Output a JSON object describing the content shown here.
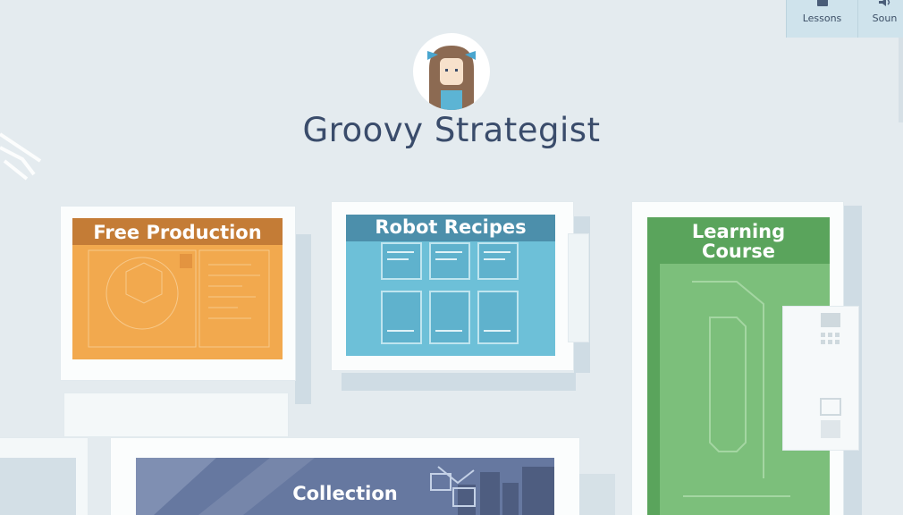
{
  "nav": {
    "lessons_label": "Lessons",
    "sound_label": "Soun"
  },
  "profile": {
    "name": "Groovy Strategist"
  },
  "tiles": {
    "free_production": "Free Production",
    "robot_recipes": "Robot Recipes",
    "learning_course_line1": "Learning",
    "learning_course_line2": "Course",
    "collection": "Collection"
  },
  "colors": {
    "background": "#e4ebef",
    "title": "#3a4c6b",
    "free_production": "#f2a94e",
    "robot_recipes": "#6dc0d8",
    "learning_course": "#7cbf7b",
    "collection": "#6678a0"
  }
}
